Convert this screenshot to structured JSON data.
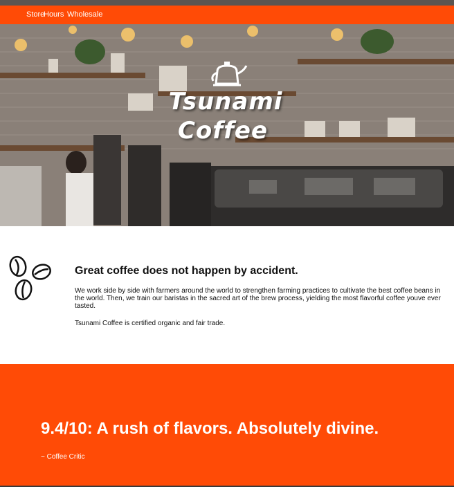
{
  "nav": {
    "links": [
      "Store",
      "Hours",
      "Wholesale"
    ]
  },
  "hero": {
    "brand_line1": "Tsunami",
    "brand_line2": "Coffee"
  },
  "intro": {
    "heading": "Great coffee does not happen by accident.",
    "paragraph1": "We work side by side with farmers around the world to strengthen farming practices to cultivate the best coffee beans in the world. Then, we train our baristas in the sacred art of the brew process, yielding the most flavorful coffee youve ever tasted.",
    "paragraph2": "Tsunami Coffee is certified organic and fair trade."
  },
  "review": {
    "quote": "9.4/10: A rush of flavors. Absolutely divine.",
    "attribution": "~ Coffee Critic"
  },
  "colors": {
    "accent": "#ff4b06",
    "text": "#111111"
  },
  "icons": [
    "kettle-icon",
    "coffee-beans-icon"
  ]
}
